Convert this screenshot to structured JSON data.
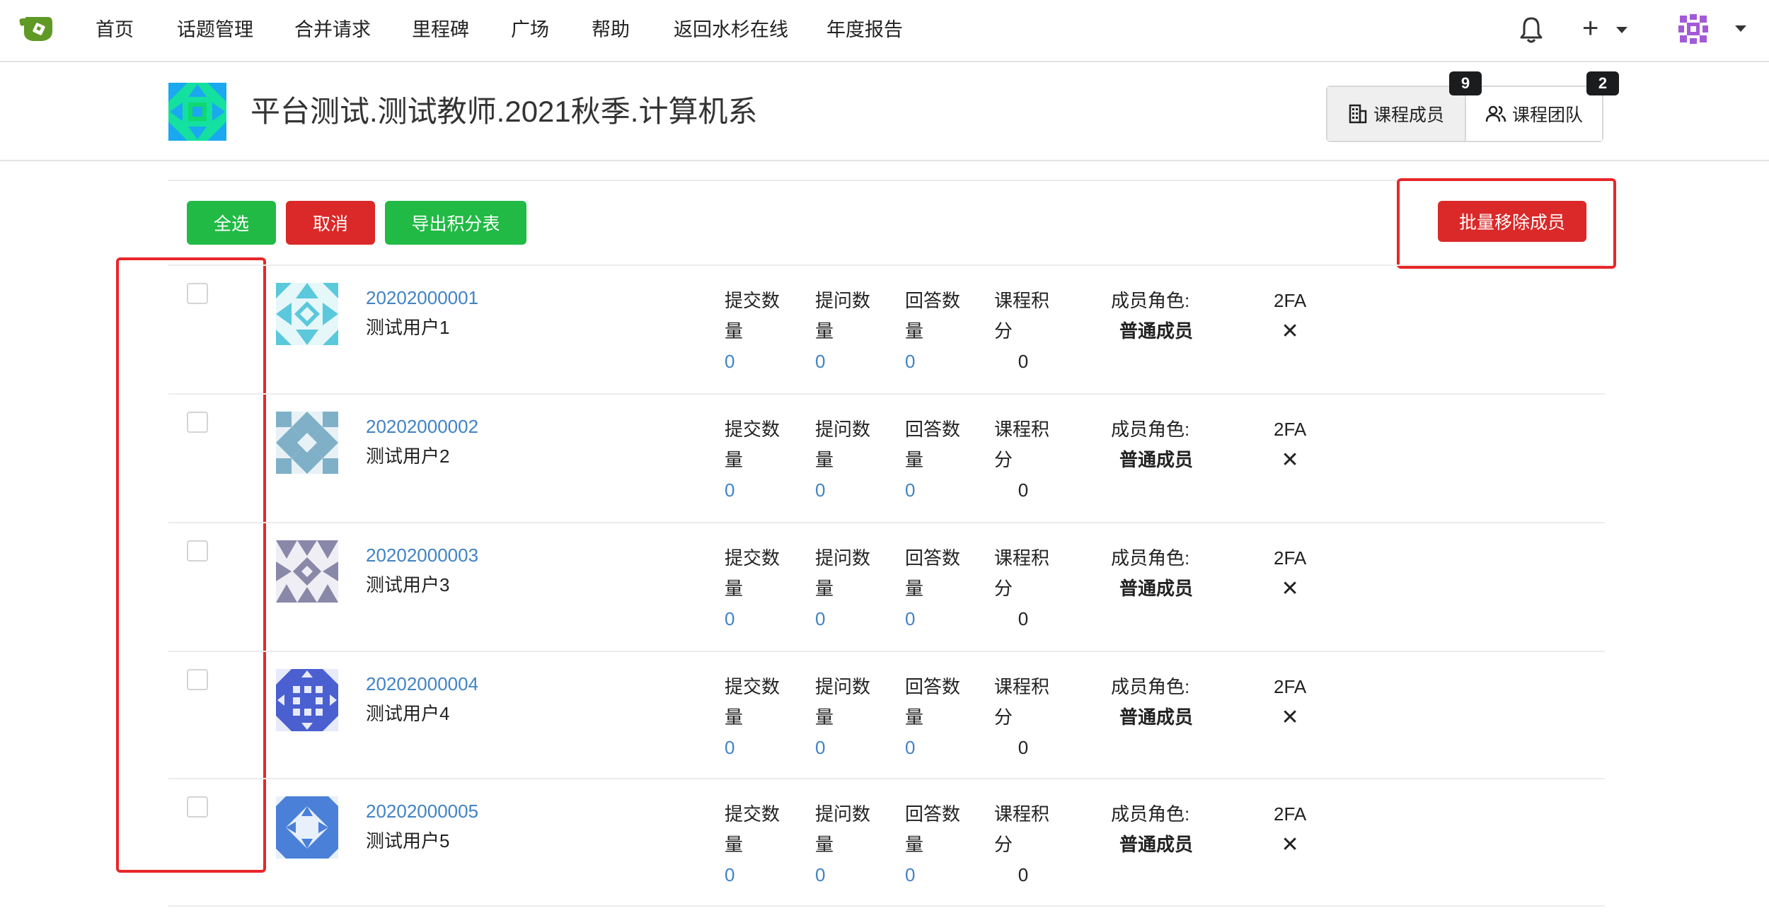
{
  "nav": {
    "items": [
      "首页",
      "话题管理",
      "合并请求",
      "里程碑",
      "广场",
      "帮助",
      "返回水杉在线",
      "年度报告"
    ],
    "plus": "+"
  },
  "repo": {
    "title": "平台测试.测试教师.2021秋季.计算机系",
    "members_label": "课程成员",
    "members_count": "9",
    "team_label": "课程团队",
    "team_count": "2"
  },
  "toolbar": {
    "select_all": "全选",
    "cancel": "取消",
    "export": "导出积分表",
    "batch_remove": "批量移除成员"
  },
  "labels": {
    "submit": "提交数量",
    "ask": "提问数量",
    "answer": "回答数量",
    "score": "课程积分",
    "role": "成员角色:",
    "tfa": "2FA",
    "tfa_mark": "✕"
  },
  "members": [
    {
      "id": "20202000001",
      "name": "测试用户1",
      "submit": "0",
      "ask": "0",
      "answer": "0",
      "score": "0",
      "role": "普通成员",
      "color": "#5bc8dc"
    },
    {
      "id": "20202000002",
      "name": "测试用户2",
      "submit": "0",
      "ask": "0",
      "answer": "0",
      "score": "0",
      "role": "普通成员",
      "color": "#7fb0c8"
    },
    {
      "id": "20202000003",
      "name": "测试用户3",
      "submit": "0",
      "ask": "0",
      "answer": "0",
      "score": "0",
      "role": "普通成员",
      "color": "#8a88a8"
    },
    {
      "id": "20202000004",
      "name": "测试用户4",
      "submit": "0",
      "ask": "0",
      "answer": "0",
      "score": "0",
      "role": "普通成员",
      "color": "#4a5fd0"
    },
    {
      "id": "20202000005",
      "name": "测试用户5",
      "submit": "0",
      "ask": "0",
      "answer": "0",
      "score": "0",
      "role": "普通成员",
      "color": "#4a80d8"
    }
  ],
  "colors": {
    "green": "#21ba45",
    "red": "#db2828",
    "link": "#4183c4",
    "highlight": "#e8272a"
  }
}
